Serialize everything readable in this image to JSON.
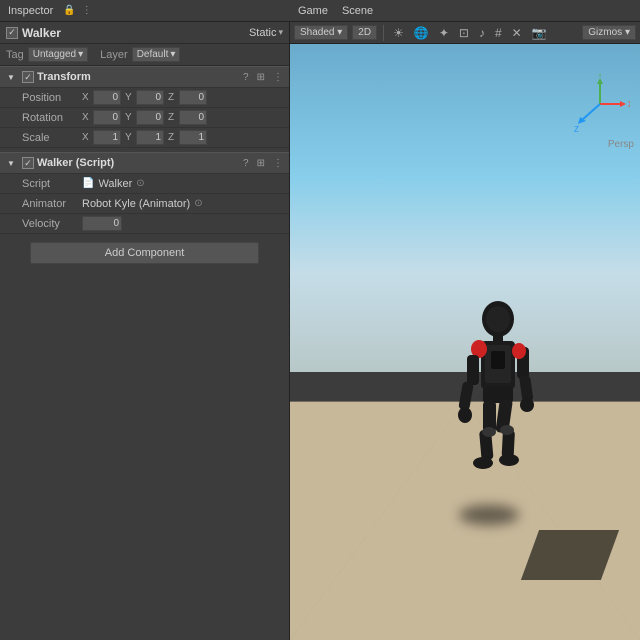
{
  "topbar": {
    "inspector_label": "Inspector",
    "lock_icon": "🔒",
    "more_icon": "⋮",
    "game_tab": "Game",
    "scene_tab": "Scene"
  },
  "inspector": {
    "object_name": "Walker",
    "static_label": "Static",
    "tag_label": "Tag",
    "tag_value": "Untagged",
    "layer_label": "Layer",
    "layer_value": "Default",
    "transform": {
      "title": "Transform",
      "position_label": "Position",
      "position": {
        "x": "0",
        "y": "0",
        "z": "0"
      },
      "rotation_label": "Rotation",
      "rotation": {
        "x": "0",
        "y": "0",
        "z": "0"
      },
      "scale_label": "Scale",
      "scale": {
        "x": "1",
        "y": "1",
        "z": "1"
      }
    },
    "walker_script": {
      "title": "Walker (Script)",
      "script_label": "Script",
      "script_value": "Walker",
      "animator_label": "Animator",
      "animator_value": "Robot Kyle (Animator)",
      "velocity_label": "Velocity",
      "velocity_value": "0"
    },
    "add_component_label": "Add Component"
  },
  "scene": {
    "shaded_label": "Shaded",
    "2d_label": "2D",
    "gizmos_label": "Gizmos",
    "persp_label": "Persp"
  },
  "toolbar_icons": {
    "icons": [
      "◉",
      "⬛",
      "↔",
      "↩",
      "⊡",
      "✕",
      "📷",
      "⊞"
    ]
  }
}
